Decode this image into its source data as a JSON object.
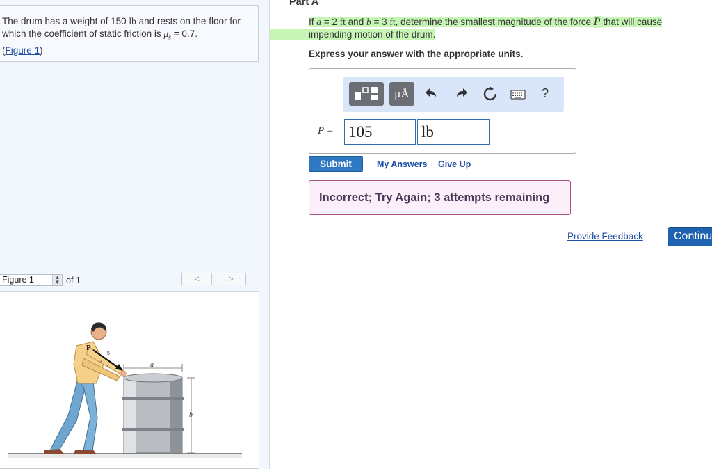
{
  "problem": {
    "text_before": "The drum has a weight of 150 ",
    "weight_unit": "lb",
    "text_middle": " and rests on the floor for which the coefficient of static friction is ",
    "mu_symbol": "μ",
    "mu_sub": "s",
    "mu_value": " = 0.7.",
    "figure_link_open": "(",
    "figure_link": "Figure 1",
    "figure_link_close": ")"
  },
  "figure_panel": {
    "select_value": "Figure 1",
    "of_text": "of 1",
    "prev_label": "<",
    "next_label": ">",
    "labels": {
      "p": "P",
      "five": "5",
      "three": "3",
      "four": "4",
      "a": "a",
      "b": "b"
    }
  },
  "part": {
    "title": "Part A",
    "q_if": "If ",
    "q_a": "a",
    "q_a_eq": " = 2 ",
    "q_ft1": "ft",
    "q_and": " and ",
    "q_b": "b",
    "q_b_eq": " = 3 ",
    "q_ft2": "ft",
    "q_rest": ", determine the smallest magnitude of the force ",
    "q_P": "P",
    "q_end": " that will cause impending motion of the drum.",
    "express": "Express your answer with the appropriate units."
  },
  "toolbar": {
    "units_btn": "μÅ",
    "undo_icon": "undo-icon",
    "redo_icon": "redo-icon",
    "reset_icon": "reset-icon",
    "keyboard_icon": "keyboard-icon",
    "help_label": "?"
  },
  "answer": {
    "label": "P =",
    "value": "105",
    "unit": "lb"
  },
  "buttons": {
    "submit": "Submit",
    "my_answers": "My Answers",
    "give_up": "Give Up"
  },
  "feedback": {
    "message": "Incorrect; Try Again; 3 attempts remaining"
  },
  "footer": {
    "provide_feedback": "Provide Feedback",
    "continue": "Continue"
  },
  "colors": {
    "highlight": "#c6f5b6",
    "submit": "#2f78c4",
    "continue": "#1e63b0",
    "feedback_border": "#a9517d"
  }
}
